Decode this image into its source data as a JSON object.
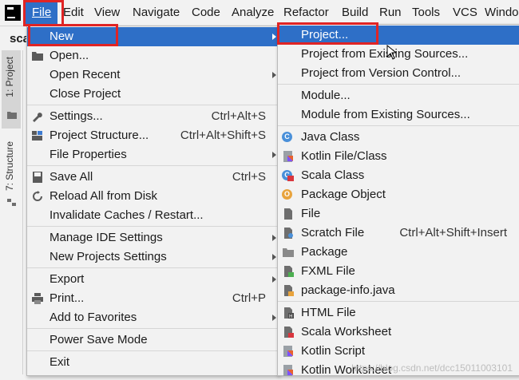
{
  "menubar": {
    "items": [
      "File",
      "Edit",
      "View",
      "Navigate",
      "Code",
      "Analyze",
      "Refactor",
      "Build",
      "Run",
      "Tools",
      "VCS",
      "Windo"
    ]
  },
  "project": {
    "tab_label": "sca"
  },
  "left_strip": {
    "project_tab": "1: Project",
    "structure_tab": "7: Structure"
  },
  "file_menu": {
    "items": [
      {
        "label": "New",
        "shortcut": "",
        "submenu": true,
        "selected": true,
        "icon": "none"
      },
      {
        "label": "Open...",
        "shortcut": "",
        "icon": "folder-icon"
      },
      {
        "label": "Open Recent",
        "shortcut": "",
        "submenu": true,
        "icon": "none"
      },
      {
        "label": "Close Project",
        "shortcut": "",
        "icon": "none"
      },
      {
        "label": "Settings...",
        "shortcut": "Ctrl+Alt+S",
        "icon": "wrench-icon"
      },
      {
        "label": "Project Structure...",
        "shortcut": "Ctrl+Alt+Shift+S",
        "icon": "project-structure-icon"
      },
      {
        "label": "File Properties",
        "shortcut": "",
        "submenu": true,
        "icon": "none"
      },
      {
        "label": "Save All",
        "shortcut": "Ctrl+S",
        "icon": "save-icon"
      },
      {
        "label": "Reload All from Disk",
        "shortcut": "",
        "icon": "reload-icon"
      },
      {
        "label": "Invalidate Caches / Restart...",
        "shortcut": "",
        "icon": "none"
      },
      {
        "label": "Manage IDE Settings",
        "shortcut": "",
        "submenu": true,
        "icon": "none"
      },
      {
        "label": "New Projects Settings",
        "shortcut": "",
        "submenu": true,
        "icon": "none"
      },
      {
        "label": "Export",
        "shortcut": "",
        "submenu": true,
        "icon": "none"
      },
      {
        "label": "Print...",
        "shortcut": "Ctrl+P",
        "icon": "print-icon"
      },
      {
        "label": "Add to Favorites",
        "shortcut": "",
        "submenu": true,
        "icon": "none"
      },
      {
        "label": "Power Save Mode",
        "shortcut": "",
        "icon": "none"
      },
      {
        "label": "Exit",
        "shortcut": "",
        "icon": "none"
      }
    ]
  },
  "new_submenu": {
    "items": [
      {
        "label": "Project...",
        "shortcut": "",
        "selected": true
      },
      {
        "label": "Project from Existing Sources...",
        "shortcut": ""
      },
      {
        "label": "Project from Version Control...",
        "shortcut": ""
      },
      {
        "label": "Module...",
        "shortcut": ""
      },
      {
        "label": "Module from Existing Sources...",
        "shortcut": ""
      },
      {
        "label": "Java Class",
        "shortcut": "",
        "icon_letter": "C"
      },
      {
        "label": "Kotlin File/Class",
        "shortcut": ""
      },
      {
        "label": "Scala Class",
        "shortcut": "",
        "icon_letter": "C"
      },
      {
        "label": "Package Object",
        "shortcut": "",
        "icon_letter": "O"
      },
      {
        "label": "File",
        "shortcut": ""
      },
      {
        "label": "Scratch File",
        "shortcut": "Ctrl+Alt+Shift+Insert"
      },
      {
        "label": "Package",
        "shortcut": ""
      },
      {
        "label": "FXML File",
        "shortcut": ""
      },
      {
        "label": "package-info.java",
        "shortcut": ""
      },
      {
        "label": "HTML File",
        "shortcut": ""
      },
      {
        "label": "Scala Worksheet",
        "shortcut": ""
      },
      {
        "label": "Kotlin Script",
        "shortcut": ""
      },
      {
        "label": "Kotlin Worksheet",
        "shortcut": ""
      }
    ]
  },
  "watermark": "https://blog.csdn.net/dcc15011003101",
  "colors": {
    "selection": "#2e6fc7",
    "highlight_box": "#e02424",
    "menu_bg": "#f2f2f2"
  }
}
